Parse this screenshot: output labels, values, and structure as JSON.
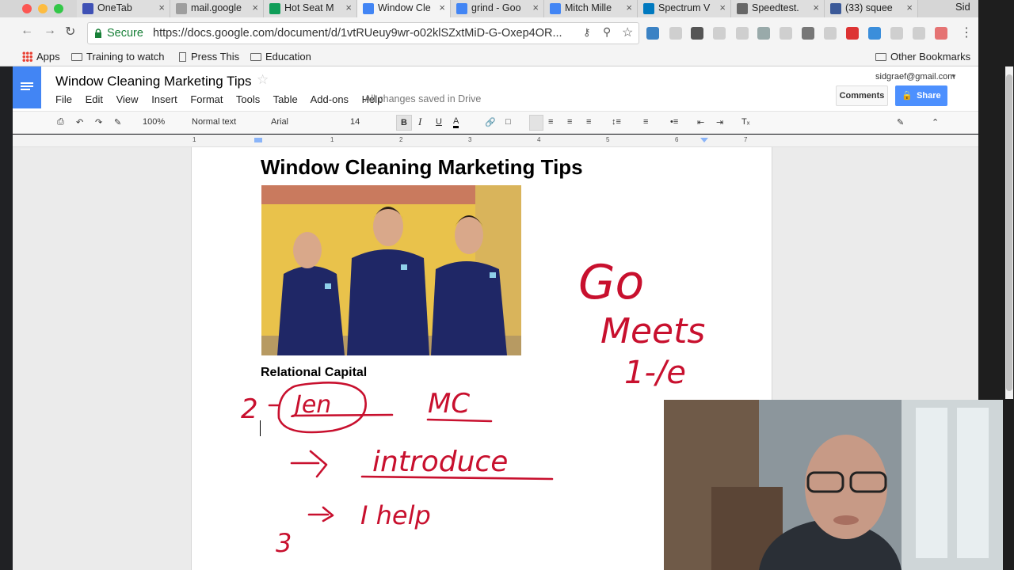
{
  "browser": {
    "tabs": [
      {
        "label": "OneTab",
        "color": "#3f51b5"
      },
      {
        "label": "mail.google",
        "color": "#9e9e9e"
      },
      {
        "label": "Hot Seat M",
        "color": "#0f9d58"
      },
      {
        "label": "Window Cle",
        "color": "#4285f4"
      },
      {
        "label": "grind - Goo",
        "color": "#4285f4"
      },
      {
        "label": "Mitch Mille",
        "color": "#4285f4"
      },
      {
        "label": "Spectrum V",
        "color": "#0079bf"
      },
      {
        "label": "Speedtest.",
        "color": "#666666"
      },
      {
        "label": "(33) squee",
        "color": "#3b5998"
      }
    ],
    "profile_name": "Sid",
    "secure_label": "Secure",
    "url": "https://docs.google.com/document/d/1vtRUeuy9wr-o02klSZxtMiD-G-Oxep4OR...",
    "bookmarks": [
      "Apps",
      "Training to watch",
      "Press This",
      "Education"
    ],
    "other_bookmarks": "Other Bookmarks"
  },
  "docs": {
    "title": "Window Cleaning Marketing Tips",
    "menus": [
      "File",
      "Edit",
      "View",
      "Insert",
      "Format",
      "Tools",
      "Table",
      "Add-ons",
      "Help"
    ],
    "save_status": "All changes saved in Drive",
    "account": "sidgraef@gmail.com",
    "comments_label": "Comments",
    "share_label": "Share",
    "zoom": "100%",
    "style": "Normal text",
    "font": "Arial",
    "font_size": "14",
    "ruler_marks": [
      "1",
      "1",
      "2",
      "3",
      "4",
      "5",
      "6",
      "7"
    ]
  },
  "document": {
    "heading": "Window Cleaning Marketing Tips",
    "subheading": "Relational Capital"
  },
  "annotations": {
    "ink_color": "#c8102e",
    "notes": [
      "Go",
      "Meets",
      "1-/e",
      "2",
      "Jen",
      "MC",
      "introduce",
      "I help",
      "3"
    ]
  }
}
